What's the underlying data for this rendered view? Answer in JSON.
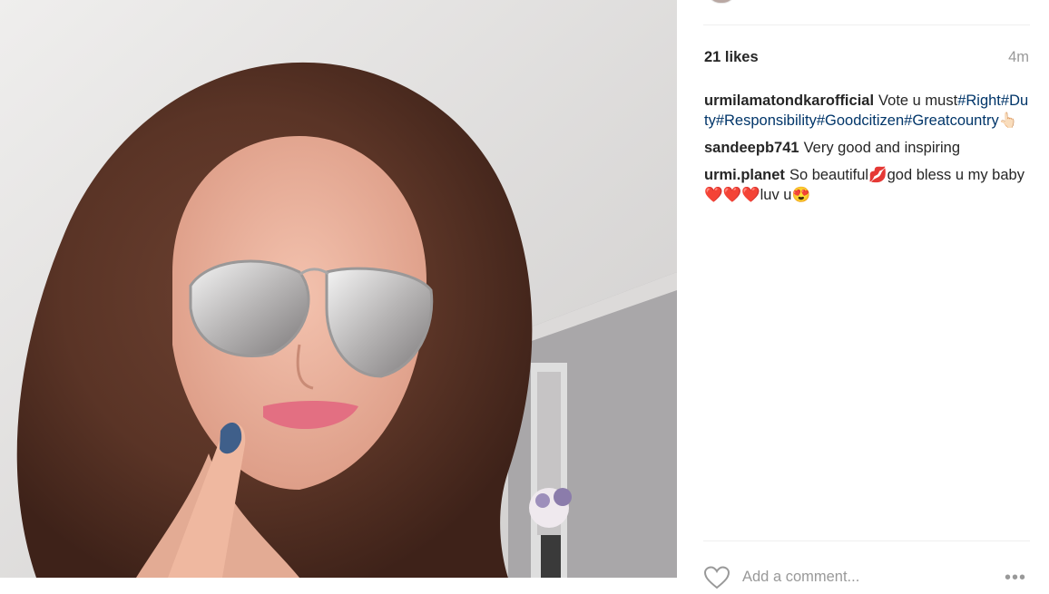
{
  "post": {
    "likes_label": "21 likes",
    "time_label": "4m"
  },
  "comments": [
    {
      "user": "urmilamatondkarofficial",
      "text": "Vote u must",
      "tags": [
        "#Right",
        "#Duty",
        "#Responsibility",
        "#Goodcitizen",
        "#Greatcountry"
      ],
      "trail": "👆🏻"
    },
    {
      "user": "sandeepb741",
      "text": "Very good and inspiring"
    },
    {
      "user": "urmi.planet",
      "text": "So beautiful💋god bless u my baby❤️❤️❤️luv u😍"
    }
  ],
  "composer": {
    "placeholder": "Add a comment...",
    "more_label": "•••",
    "like_icon": "heart-icon"
  },
  "colors": {
    "hashtag": "#003569",
    "text": "#262626",
    "muted": "#999999",
    "divider": "#efefef"
  }
}
